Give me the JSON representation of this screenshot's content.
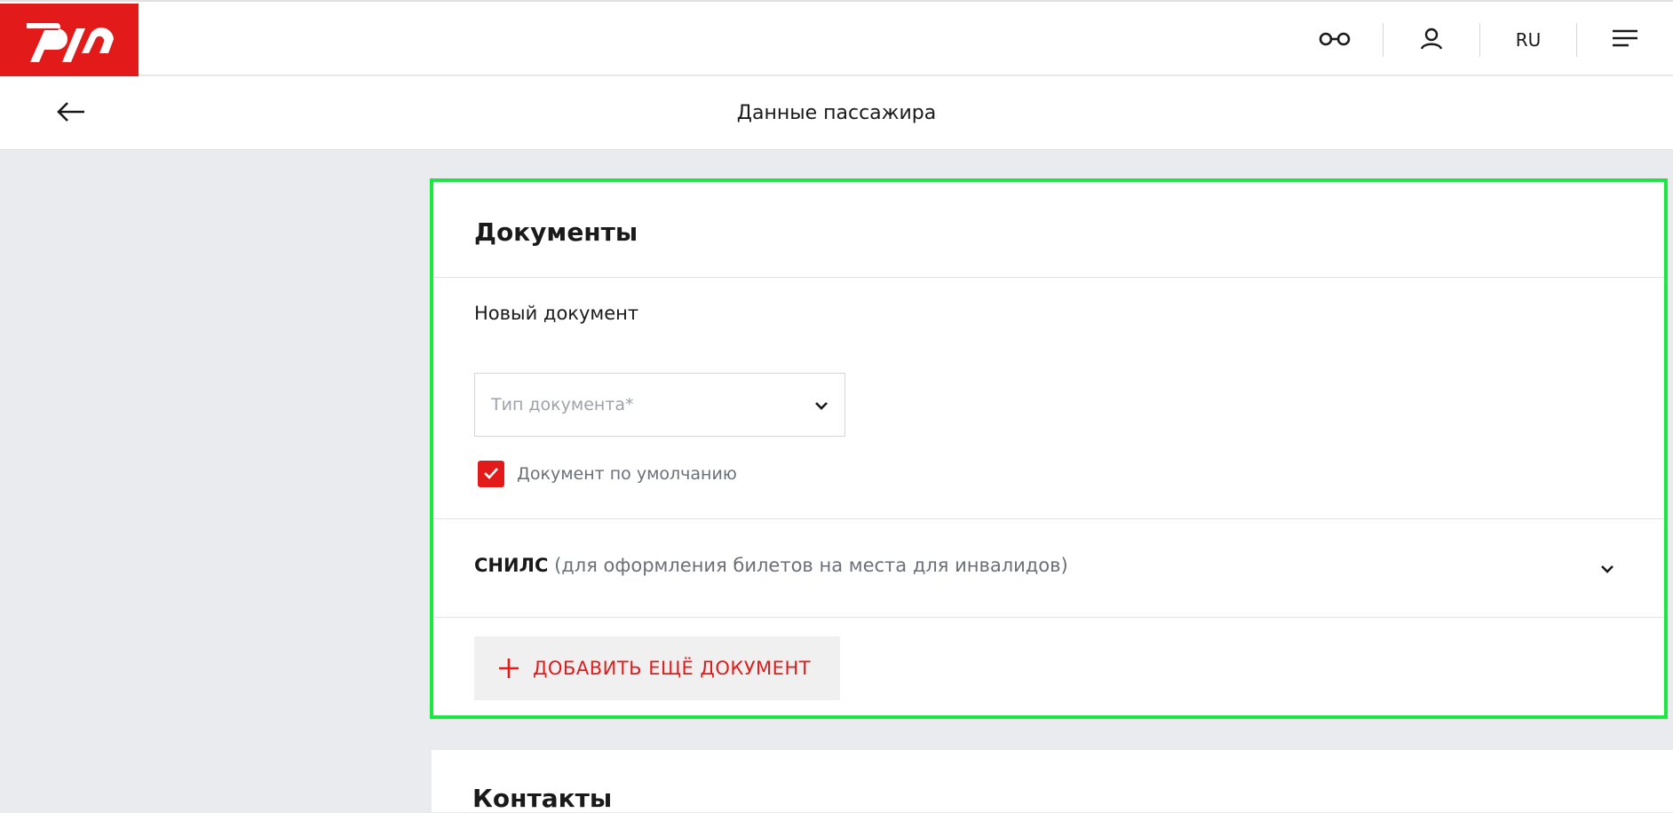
{
  "header": {
    "logo_text": "РЖД",
    "brand_color": "#e21a1a",
    "accessibility_icon": "glasses-icon",
    "profile_icon": "user-icon",
    "language": "RU",
    "menu_icon": "hamburger-menu-icon"
  },
  "subheader": {
    "back_icon": "arrow-left-icon",
    "title": "Данные пассажира"
  },
  "documents": {
    "title": "Документы",
    "new_document_title": "Новый документ",
    "doc_type_placeholder": "Тип документа*",
    "default_checkbox_label": "Документ по умолчанию",
    "default_checked": true,
    "snils_label": "СНИЛС",
    "snils_note": " (для оформления билетов на места для инвалидов)",
    "add_button_label": "ДОБАВИТЬ ЕЩЁ ДОКУМЕНТ",
    "highlight_color": "#1be83f"
  },
  "contacts": {
    "title": "Контакты"
  }
}
